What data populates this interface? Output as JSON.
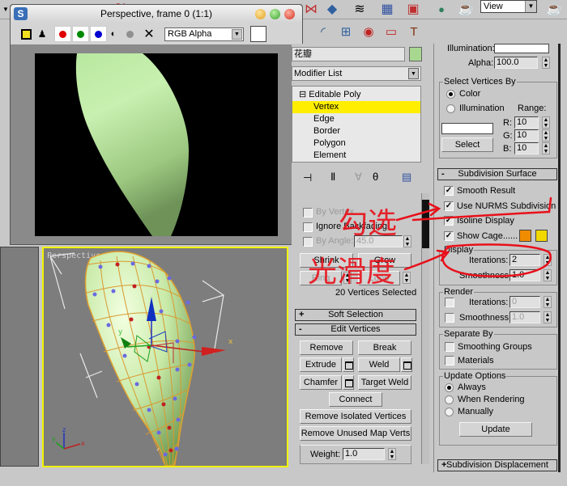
{
  "top_toolbar": {
    "view_select": "View",
    "icons": [
      "select-object-icon",
      "snap-3d-icon",
      "angle-snap-icon",
      "percent-snap-icon",
      "spinner-snap-icon",
      "mirror-icon",
      "align-icon",
      "layer-manager-icon",
      "curve-editor-icon",
      "schematic-view-icon",
      "material-editor-icon",
      "render-scene-icon",
      "quick-render-icon"
    ]
  },
  "command_tabs": [
    "create-icon",
    "modify-icon",
    "hierarchy-icon",
    "motion-icon",
    "display-icon",
    "utilities-icon"
  ],
  "render_window": {
    "title": "Perspective, frame 0 (1:1)",
    "logo": "S",
    "channel_select": "RGB Alpha",
    "channels": [
      {
        "name": "red",
        "color": "#e00000"
      },
      {
        "name": "green",
        "color": "#008a00"
      },
      {
        "name": "blue",
        "color": "#0000d0"
      }
    ]
  },
  "viewport": {
    "label": "Perspective",
    "gizmo_axes": {
      "x": "x",
      "y": "y",
      "z": "z"
    },
    "selection_color": "#f2f200"
  },
  "modifier_panel": {
    "object_name": "花瓣",
    "object_color": "#a8d890",
    "modifier_list": "Modifier List",
    "stack": {
      "root": "Editable Poly",
      "items": [
        "Vertex",
        "Edge",
        "Border",
        "Polygon",
        "Element"
      ],
      "selected": "Vertex"
    },
    "selection": {
      "by_vertex": "By Vertex",
      "ignore_backfacing": "Ignore Backfacing",
      "by_angle": "By Angle:",
      "by_angle_value": "45.0",
      "shrink": "Shrink",
      "grow": "Grow",
      "ring": "Ring",
      "loop": "Loop",
      "status": "20 Vertices Selected"
    },
    "soft_selection": {
      "sign": "+",
      "title": "Soft Selection"
    },
    "edit_vertices": {
      "sign": "-",
      "title": "Edit Vertices",
      "remove": "Remove",
      "break": "Break",
      "extrude": "Extrude",
      "weld": "Weld",
      "chamfer": "Chamfer",
      "target_weld": "Target Weld",
      "connect": "Connect",
      "remove_isolated": "Remove Isolated Vertices",
      "remove_unused": "Remove Unused Map Verts",
      "weight_label": "Weight:",
      "weight_value": "1.0"
    }
  },
  "right_panel": {
    "illumination_label": "Illumination:",
    "alpha_label": "Alpha:",
    "alpha_value": "100.0",
    "select_vertices_by": {
      "title": "Select Vertices By",
      "color": "Color",
      "illumination": "Illumination",
      "range": "Range:",
      "r_label": "R:",
      "r_value": "10",
      "g_label": "G:",
      "g_value": "10",
      "b_label": "B:",
      "b_value": "10",
      "select": "Select",
      "mode": "Color"
    },
    "subdivision_surface": {
      "sign": "-",
      "title": "Subdivision Surface",
      "smooth_result": {
        "label": "Smooth Result",
        "checked": true
      },
      "use_nurms": {
        "label": "Use NURMS Subdivision",
        "checked": true
      },
      "isoline": {
        "label": "Isoline Display",
        "checked": true
      },
      "show_cage": {
        "label": "Show Cage......",
        "checked": true
      },
      "cage_colors": [
        "#f08c00",
        "#f0d800"
      ],
      "display": {
        "title": "Display",
        "iterations_label": "Iterations:",
        "iterations_value": "2",
        "smoothness_label": "Smoothness:",
        "smoothness_value": "1.0"
      },
      "render": {
        "title": "Render",
        "iterations_label": "Iterations:",
        "iterations_value": "0",
        "smoothness_label": "Smoothness:",
        "smoothness_value": "1.0"
      },
      "separate_by": {
        "title": "Separate By",
        "smoothing_groups": "Smoothing Groups",
        "materials": "Materials"
      },
      "update_options": {
        "title": "Update Options",
        "always": "Always",
        "when_rendering": "When Rendering",
        "manually": "Manually",
        "selected": "Always",
        "update": "Update"
      }
    },
    "subdivision_displacement": {
      "sign": "+",
      "title": "Subdivision Displacement"
    }
  },
  "annotations": {
    "text_top": "勾选",
    "text_bottom": "光滑度",
    "color": "#e8101a"
  }
}
